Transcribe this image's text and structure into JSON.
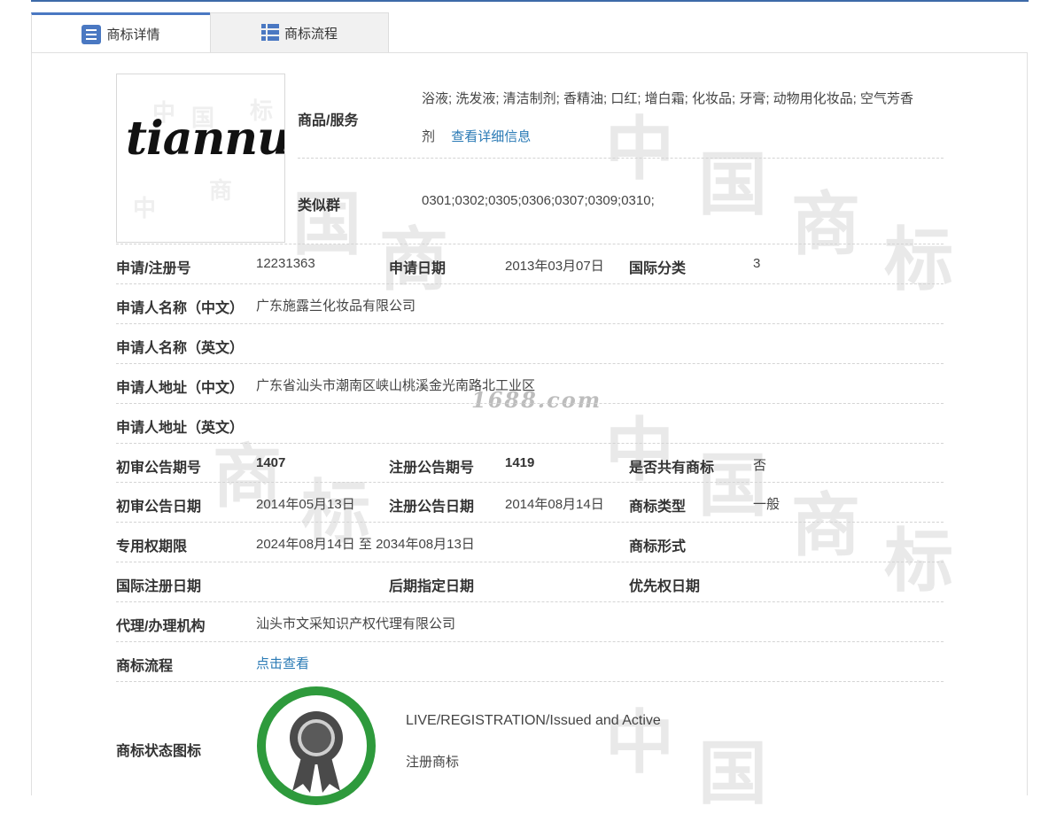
{
  "tabs": [
    {
      "label": "商标详情",
      "icon": "list-icon",
      "active": true
    },
    {
      "label": "商标流程",
      "icon": "table-icon",
      "active": false
    }
  ],
  "logo": {
    "text": "tiannuo"
  },
  "watermark": {
    "chars": [
      "中",
      "国",
      "商",
      "标"
    ],
    "site": "1688.com"
  },
  "goods": {
    "label": "商品/服务",
    "line1": "浴液; 洗发液; 清洁制剂; 香精油; 口红; 增白霜; 化妆品; 牙膏; 动物用化妆品; 空气芳香",
    "line2": "剂",
    "detail_link": "查看详细信息"
  },
  "similar": {
    "label": "类似群",
    "value": "0301;0302;0305;0306;0307;0309;0310;"
  },
  "fields": {
    "reg_no": {
      "label": "申请/注册号",
      "value": "12231363"
    },
    "apply_date": {
      "label": "申请日期",
      "value": "2013年03月07日"
    },
    "intl_class": {
      "label": "国际分类",
      "value": "3"
    },
    "applicant_cn": {
      "label": "申请人名称（中文）",
      "value": "广东施露兰化妆品有限公司"
    },
    "applicant_en": {
      "label": "申请人名称（英文）",
      "value": ""
    },
    "address_cn": {
      "label": "申请人地址（中文）",
      "value": "广东省汕头市潮南区峡山桃溪金光南路北工业区"
    },
    "address_en": {
      "label": "申请人地址（英文）",
      "value": ""
    },
    "prelim_issue": {
      "label": "初审公告期号",
      "value": "1407"
    },
    "reg_issue": {
      "label": "注册公告期号",
      "value": "1419"
    },
    "shared": {
      "label": "是否共有商标",
      "value": "否"
    },
    "prelim_date": {
      "label": "初审公告日期",
      "value": "2014年05月13日"
    },
    "reg_date": {
      "label": "注册公告日期",
      "value": "2014年08月14日"
    },
    "tm_type": {
      "label": "商标类型",
      "value": "一般"
    },
    "exclusive": {
      "label": "专用权期限",
      "value": "2024年08月14日 至 2034年08月13日"
    },
    "tm_form": {
      "label": "商标形式",
      "value": ""
    },
    "intl_reg_date": {
      "label": "国际注册日期",
      "value": ""
    },
    "later_date": {
      "label": "后期指定日期",
      "value": ""
    },
    "priority_date": {
      "label": "优先权日期",
      "value": ""
    },
    "agent": {
      "label": "代理/办理机构",
      "value": "汕头市文采知识产权代理有限公司"
    },
    "flow": {
      "label": "商标流程",
      "value": "点击查看"
    }
  },
  "status": {
    "label": "商标状态图标",
    "line1": "LIVE/REGISTRATION/Issued and Active",
    "line2": "注册商标",
    "colors": {
      "ring": "#2e9a3c",
      "medal": "#4a4a4a"
    }
  }
}
